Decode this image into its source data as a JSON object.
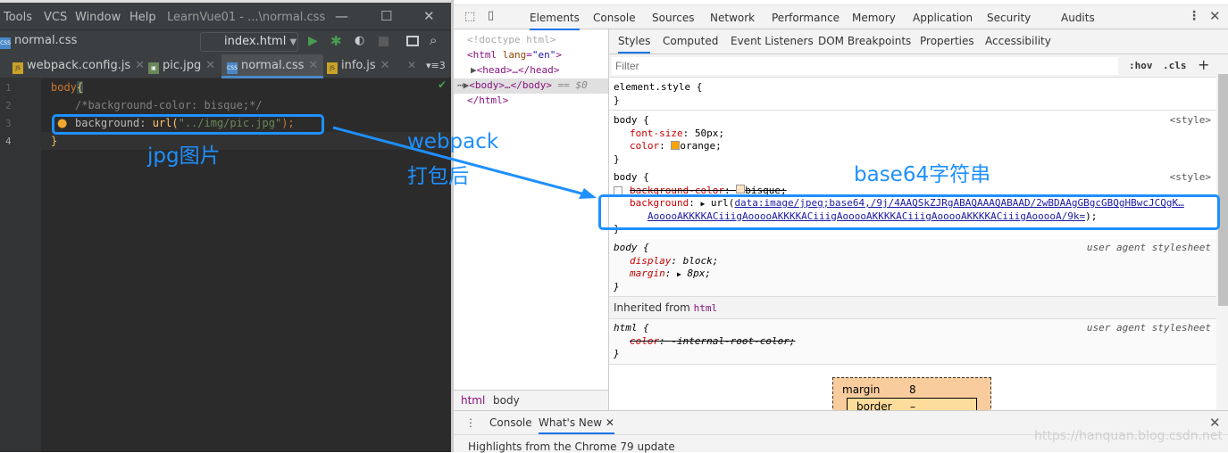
{
  "ide": {
    "menu": [
      "Tools",
      "VCS",
      "Window",
      "Help"
    ],
    "window_title": "LearnVue01 - ...\\normal.css",
    "breadcrumb_file": "normal.css",
    "run_config": "index.html",
    "tabs": [
      {
        "label": "webpack.config.js",
        "type": "JS"
      },
      {
        "label": "pic.jpg",
        "type": "IMG"
      },
      {
        "label": "normal.css",
        "type": "CSS",
        "active": true
      },
      {
        "label": "info.js",
        "type": "JS"
      }
    ],
    "tab_overflow": "3",
    "lines": [
      "1",
      "2",
      "3",
      "4"
    ],
    "code": {
      "l1_sel": "body",
      "l1_brace": "{",
      "l2": "/*background-color: bisque;*/",
      "l3_prop": "background: ",
      "l3_fn": "url(",
      "l3_str": "\"../img/pic.jpg\"",
      "l3_end": ");",
      "l4": "}"
    }
  },
  "annotations": {
    "jpg": "jpg图片",
    "webpack1": "webpack",
    "webpack2": "打包后",
    "base64": "base64字符串",
    "color": "#1e90ff"
  },
  "devtools": {
    "tabs": [
      "Elements",
      "Console",
      "Sources",
      "Network",
      "Performance",
      "Memory",
      "Application",
      "Security",
      "Audits"
    ],
    "dom": {
      "doctype": "<!doctype html>",
      "html_open": "<html ",
      "lang_attr": "lang",
      "lang_val": "\"en\"",
      "head": "<head>…</head>",
      "body": "<body>…</body>",
      "body_marker": "== $0",
      "html_close": "</html>"
    },
    "breadcrumbs": [
      "html",
      "body"
    ],
    "style_tabs": [
      "Styles",
      "Computed",
      "Event Listeners",
      "DOM Breakpoints",
      "Properties",
      "Accessibility"
    ],
    "filter_placeholder": "Filter",
    "hov": ":hov",
    "cls": ".cls",
    "element_style": "element.style {",
    "rule1": {
      "selector": "body {",
      "source": "<style>",
      "p1": "font-size",
      "v1": "50px;",
      "p2": "color",
      "v2": "orange;"
    },
    "rule2": {
      "selector": "body {",
      "source": "<style>",
      "p1": "background-color",
      "v1": "bisque;",
      "p2": "background",
      "url1": "data:image/jpeg;base64,/9j/4AAQSkZJRgABAQAAAQABAAD/2wBDAAgGBgcGBQgHBwcJCQgK…",
      "url2": "AooooAKKKKACiiigAooooAKKKKACiiigAooooAKKKKACiiigAooooAKKKKACiiigAooooA/9k="
    },
    "rule3": {
      "selector": "body {",
      "source": "user agent stylesheet",
      "p1": "display",
      "v1": "block;",
      "p2": "margin",
      "v2": "8px;"
    },
    "inherited_label": "Inherited from ",
    "inherited_el": "html",
    "rule4": {
      "selector": "html {",
      "source": "user agent stylesheet",
      "p1": "color",
      "v1": "-internal-root-color;"
    },
    "boxmodel": {
      "margin_label": "margin",
      "margin_val": "8",
      "border_label": "border",
      "border_val": "–"
    },
    "drawer_tabs": [
      "Console",
      "What's New"
    ],
    "drawer_text": "Highlights from the Chrome 79 update"
  },
  "watermark": "https://hanquan.blog.csdn.net"
}
